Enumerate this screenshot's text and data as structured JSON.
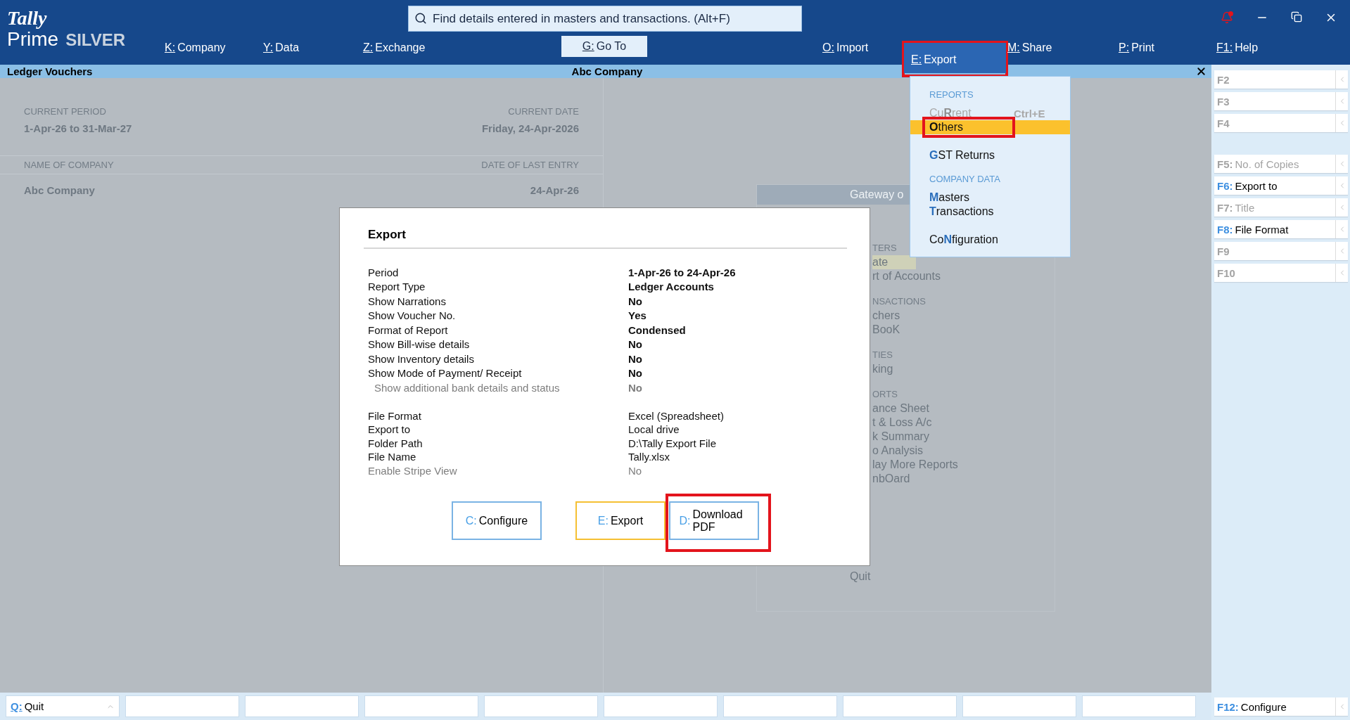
{
  "logo": {
    "brand": "Tally",
    "product": "Prime",
    "edition": "SILVER"
  },
  "search": {
    "placeholder": "Find details entered in masters and transactions. (Alt+F)"
  },
  "menu": [
    {
      "key": "K:",
      "label": "Company",
      "selected": false,
      "open": false,
      "highlighted": false
    },
    {
      "key": "Y:",
      "label": "Data",
      "selected": false,
      "open": false,
      "highlighted": false
    },
    {
      "key": "Z:",
      "label": "Exchange",
      "selected": false,
      "open": false,
      "highlighted": false
    },
    {
      "key": "G:",
      "label": "Go To",
      "selected": true,
      "open": false,
      "highlighted": false
    },
    {
      "key": "O:",
      "label": "Import",
      "selected": false,
      "open": false,
      "highlighted": false
    },
    {
      "key": "E:",
      "label": "Export",
      "selected": false,
      "open": true,
      "highlighted": true
    },
    {
      "key": "M:",
      "label": "Share",
      "selected": false,
      "open": false,
      "highlighted": false
    },
    {
      "key": "P:",
      "label": "Print",
      "selected": false,
      "open": false,
      "highlighted": false
    },
    {
      "key": "F1:",
      "label": "Help",
      "selected": false,
      "open": false,
      "highlighted": false
    }
  ],
  "export_menu": {
    "sections": [
      {
        "title": "REPORTS",
        "groups": [
          [
            {
              "before": "Cu",
              "key": "R",
              "after": "rent",
              "shortcut": "Ctrl+E",
              "disabled": true,
              "selected": false,
              "highlighted": false
            },
            {
              "key": "O",
              "after": "thers",
              "disabled": false,
              "selected": true,
              "highlighted": true
            }
          ],
          [
            {
              "key": "G",
              "after": "ST Returns",
              "disabled": false,
              "selected": false,
              "highlighted": false
            }
          ]
        ]
      },
      {
        "title": "COMPANY DATA",
        "groups": [
          [
            {
              "key": "M",
              "after": "asters",
              "disabled": false,
              "selected": false,
              "highlighted": false
            },
            {
              "key": "T",
              "after": "ransactions",
              "disabled": false,
              "selected": false,
              "highlighted": false
            }
          ],
          [
            {
              "before": "Co",
              "key": "N",
              "after": "figuration",
              "disabled": false,
              "selected": false,
              "highlighted": false
            }
          ]
        ]
      }
    ]
  },
  "title_bar": {
    "report": "Ledger Vouchers",
    "company": "Abc Company"
  },
  "company_info": {
    "current_period_label": "CURRENT PERIOD",
    "current_period": "1-Apr-26 to 31-Mar-27",
    "current_date_label": "CURRENT DATE",
    "current_date": "Friday, 24-Apr-2026",
    "company_label": "NAME OF COMPANY",
    "last_entry_label": "DATE OF LAST ENTRY",
    "company": "Abc Company",
    "last_entry": "24-Apr-26"
  },
  "gateway": {
    "title": "Gateway o",
    "items": [
      {
        "kind": "section",
        "text": "TERS"
      },
      {
        "kind": "item",
        "text": "ate",
        "selected": true
      },
      {
        "kind": "item",
        "text": "rt of Accounts",
        "selected": false
      },
      {
        "kind": "section",
        "text": "NSACTIONS"
      },
      {
        "kind": "item",
        "text": "chers",
        "selected": false
      },
      {
        "kind": "item",
        "text": "BooK",
        "selected": false
      },
      {
        "kind": "section",
        "text": "TIES"
      },
      {
        "kind": "item",
        "text": "king",
        "selected": false
      },
      {
        "kind": "section",
        "text": "ORTS"
      },
      {
        "kind": "item",
        "text": "ance Sheet",
        "selected": false
      },
      {
        "kind": "item",
        "text": "t & Loss A/c",
        "selected": false
      },
      {
        "kind": "item",
        "text": "k Summary",
        "selected": false
      },
      {
        "kind": "item",
        "text": "o Analysis",
        "selected": false
      },
      {
        "kind": "item",
        "text": "lay More Reports",
        "selected": false
      },
      {
        "kind": "item",
        "text": "nbOard",
        "selected": false
      }
    ],
    "quit": "Quit"
  },
  "dialog": {
    "title": "Export",
    "sections": [
      {
        "kind": "options",
        "rows": [
          {
            "label": "Period",
            "value": "1-Apr-26 to 24-Apr-26",
            "disabled": false
          },
          {
            "label": "Report Type",
            "value": "Ledger Accounts",
            "disabled": false
          },
          {
            "label": "Show Narrations",
            "value": "No",
            "disabled": false
          },
          {
            "label": "Show Voucher No.",
            "value": "Yes",
            "disabled": false
          },
          {
            "label": "Format of Report",
            "value": "Condensed",
            "disabled": false
          },
          {
            "label": "Show Bill-wise details",
            "value": "No",
            "disabled": false
          },
          {
            "label": "Show Inventory details",
            "value": "No",
            "disabled": false
          },
          {
            "label": "Show Mode of Payment/ Receipt",
            "value": "No",
            "disabled": false,
            "children": [
              {
                "label": "Show additional bank details and status",
                "value": "No",
                "disabled": true
              }
            ]
          }
        ]
      },
      {
        "kind": "file",
        "rows": [
          {
            "label": "File Format",
            "value": "Excel (Spreadsheet)",
            "disabled": false
          },
          {
            "label": "Export to",
            "value": "Local drive",
            "disabled": false
          },
          {
            "label": "Folder Path",
            "value": "D:\\Tally Export File",
            "disabled": false
          },
          {
            "label": "File Name",
            "value": "Tally.xlsx",
            "disabled": false
          },
          {
            "label": "Enable Stripe View",
            "value": "No",
            "disabled": true
          }
        ]
      }
    ],
    "buttons": [
      {
        "key": "C:",
        "label": "Configure",
        "selected": false,
        "highlighted": false
      },
      {
        "key": "E:",
        "label": "Export",
        "selected": true,
        "highlighted": false
      },
      {
        "key": "D:",
        "label": "Download PDF",
        "selected": false,
        "highlighted": true
      }
    ]
  },
  "function_keys": [
    [
      {
        "key": "F2",
        "disabled": true
      },
      {
        "key": "F3",
        "disabled": true
      },
      {
        "key": "F4",
        "disabled": true
      }
    ],
    [
      {
        "key": "F5:",
        "label": "No. of Copies",
        "disabled": true
      },
      {
        "key": "F6:",
        "label": "Export to",
        "disabled": false
      },
      {
        "key": "F7:",
        "label": "Title",
        "disabled": true
      },
      {
        "key": "F8:",
        "label": "File Format",
        "disabled": false
      },
      {
        "key": "F9",
        "disabled": true
      },
      {
        "key": "F10",
        "disabled": true
      }
    ]
  ],
  "bottom_bar": {
    "quit": {
      "key": "Q:",
      "label": "Quit"
    },
    "configure": {
      "key": "F12:",
      "label": "Configure"
    }
  }
}
